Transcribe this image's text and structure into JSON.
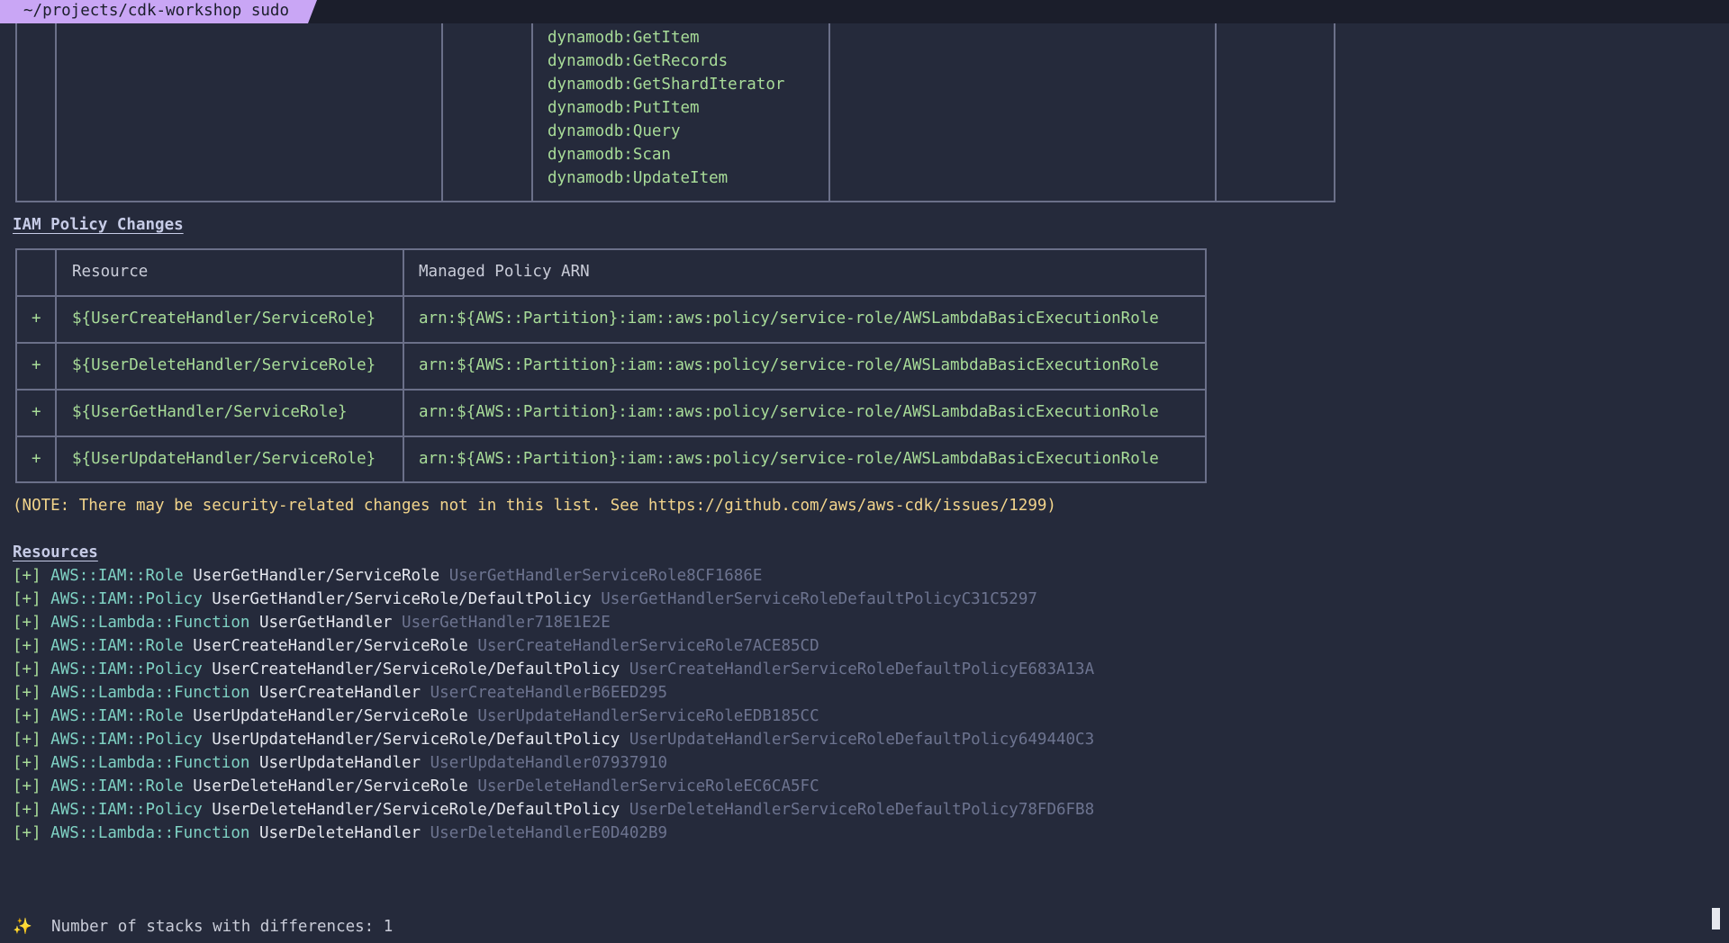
{
  "title_bar": {
    "path_label": "~/projects/cdk-workshop sudo"
  },
  "statement_actions": [
    "dynamodb:GetItem",
    "dynamodb:GetRecords",
    "dynamodb:GetShardIterator",
    "dynamodb:PutItem",
    "dynamodb:Query",
    "dynamodb:Scan",
    "dynamodb:UpdateItem"
  ],
  "iam_policy": {
    "heading": "IAM Policy Changes",
    "columns": [
      "Resource",
      "Managed Policy ARN"
    ],
    "rows": [
      {
        "sign": "+",
        "resource": "${UserCreateHandler/ServiceRole}",
        "arn": "arn:${AWS::Partition}:iam::aws:policy/service-role/AWSLambdaBasicExecutionRole"
      },
      {
        "sign": "+",
        "resource": "${UserDeleteHandler/ServiceRole}",
        "arn": "arn:${AWS::Partition}:iam::aws:policy/service-role/AWSLambdaBasicExecutionRole"
      },
      {
        "sign": "+",
        "resource": "${UserGetHandler/ServiceRole}",
        "arn": "arn:${AWS::Partition}:iam::aws:policy/service-role/AWSLambdaBasicExecutionRole"
      },
      {
        "sign": "+",
        "resource": "${UserUpdateHandler/ServiceRole}",
        "arn": "arn:${AWS::Partition}:iam::aws:policy/service-role/AWSLambdaBasicExecutionRole"
      }
    ]
  },
  "note": "(NOTE: There may be security-related changes not in this list. See https://github.com/aws/aws-cdk/issues/1299)",
  "resources": {
    "heading": "Resources",
    "items": [
      {
        "prefix": "[+]",
        "type": "AWS::IAM::Role",
        "path": "UserGetHandler/ServiceRole",
        "logical_id": "UserGetHandlerServiceRole8CF1686E"
      },
      {
        "prefix": "[+]",
        "type": "AWS::IAM::Policy",
        "path": "UserGetHandler/ServiceRole/DefaultPolicy",
        "logical_id": "UserGetHandlerServiceRoleDefaultPolicyC31C5297"
      },
      {
        "prefix": "[+]",
        "type": "AWS::Lambda::Function",
        "path": "UserGetHandler",
        "logical_id": "UserGetHandler718E1E2E"
      },
      {
        "prefix": "[+]",
        "type": "AWS::IAM::Role",
        "path": "UserCreateHandler/ServiceRole",
        "logical_id": "UserCreateHandlerServiceRole7ACE85CD"
      },
      {
        "prefix": "[+]",
        "type": "AWS::IAM::Policy",
        "path": "UserCreateHandler/ServiceRole/DefaultPolicy",
        "logical_id": "UserCreateHandlerServiceRoleDefaultPolicyE683A13A"
      },
      {
        "prefix": "[+]",
        "type": "AWS::Lambda::Function",
        "path": "UserCreateHandler",
        "logical_id": "UserCreateHandlerB6EED295"
      },
      {
        "prefix": "[+]",
        "type": "AWS::IAM::Role",
        "path": "UserUpdateHandler/ServiceRole",
        "logical_id": "UserUpdateHandlerServiceRoleEDB185CC"
      },
      {
        "prefix": "[+]",
        "type": "AWS::IAM::Policy",
        "path": "UserUpdateHandler/ServiceRole/DefaultPolicy",
        "logical_id": "UserUpdateHandlerServiceRoleDefaultPolicy649440C3"
      },
      {
        "prefix": "[+]",
        "type": "AWS::Lambda::Function",
        "path": "UserUpdateHandler",
        "logical_id": "UserUpdateHandler07937910"
      },
      {
        "prefix": "[+]",
        "type": "AWS::IAM::Role",
        "path": "UserDeleteHandler/ServiceRole",
        "logical_id": "UserDeleteHandlerServiceRoleEC6CA5FC"
      },
      {
        "prefix": "[+]",
        "type": "AWS::IAM::Policy",
        "path": "UserDeleteHandler/ServiceRole/DefaultPolicy",
        "logical_id": "UserDeleteHandlerServiceRoleDefaultPolicy78FD6FB8"
      },
      {
        "prefix": "[+]",
        "type": "AWS::Lambda::Function",
        "path": "UserDeleteHandler",
        "logical_id": "UserDeleteHandlerE0D402B9"
      }
    ]
  },
  "summary": {
    "icon": "sparkles-icon",
    "glyph": "✨",
    "text": "Number of stacks with differences: 1"
  },
  "colors": {
    "background": "#252a3b",
    "tab": "#c9a6f5",
    "added": "#a8dc98",
    "type": "#7fd2c4",
    "logical_id": "#6d7490",
    "note": "#f2d48b"
  }
}
